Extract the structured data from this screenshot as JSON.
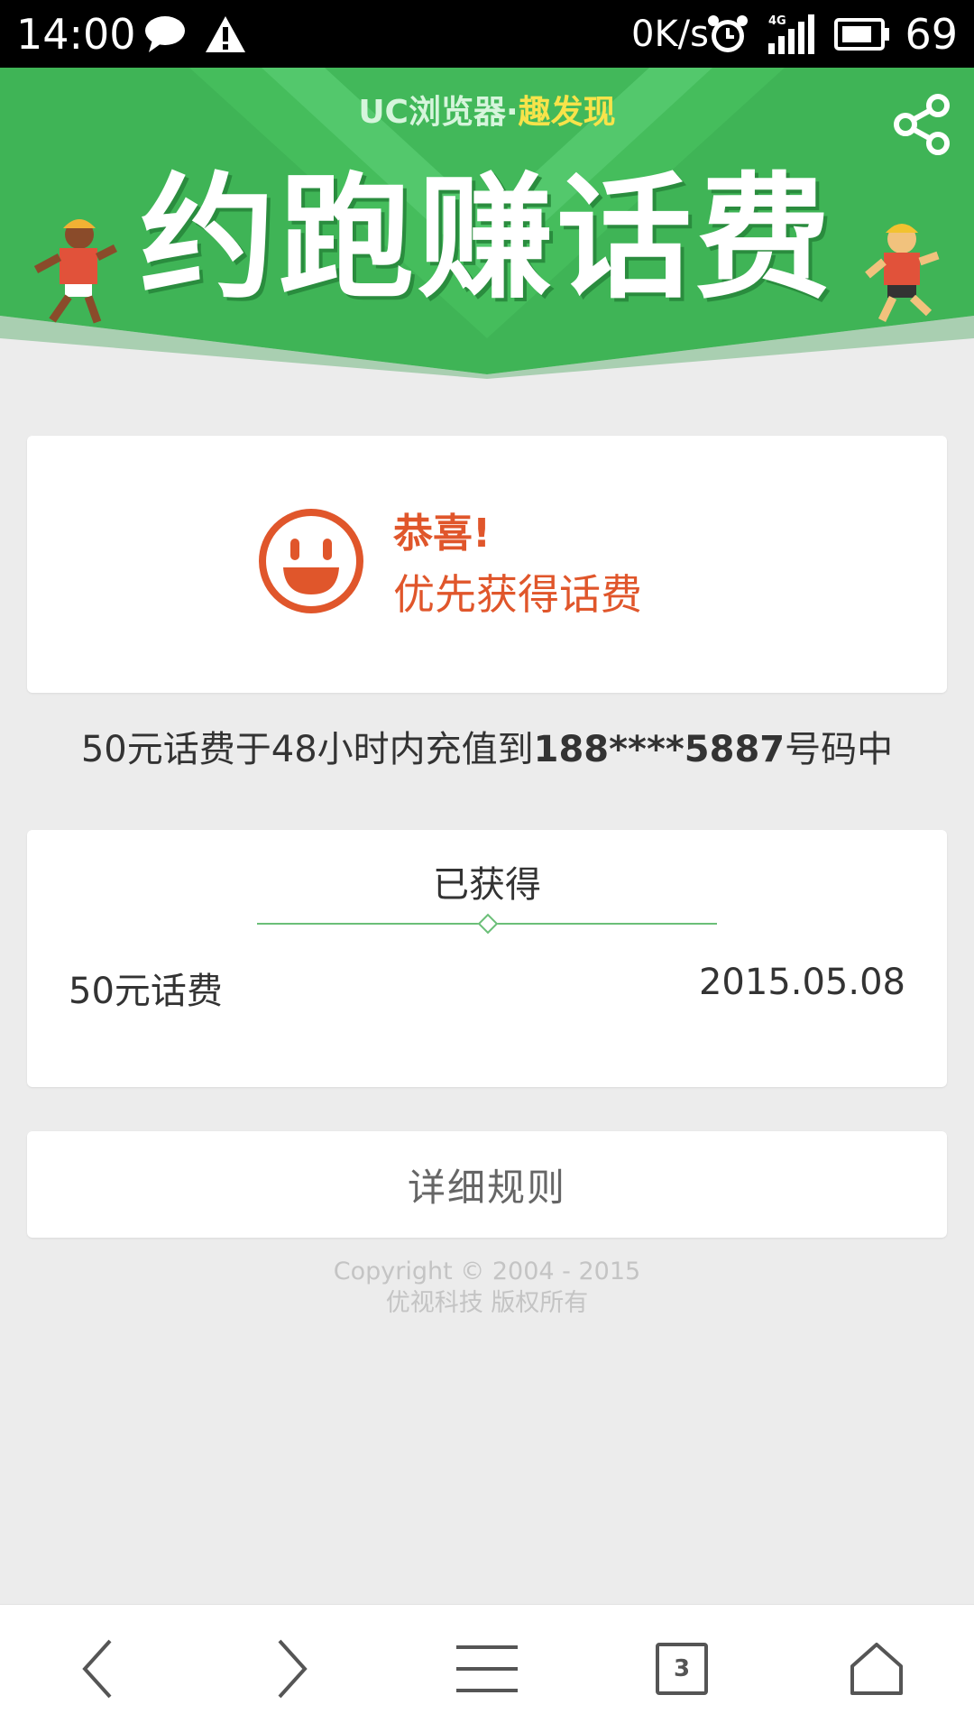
{
  "status_bar": {
    "time": "14:00",
    "speed": "0K/s",
    "network": "4G",
    "battery": "69",
    "icons": [
      "message-icon",
      "warning-icon",
      "alarm-icon",
      "signal-icon",
      "battery-icon"
    ]
  },
  "banner": {
    "brand": "UC浏览器",
    "brand_accent": "趣发现",
    "headline": "约跑赚话费",
    "share_icon": "share-icon"
  },
  "congrats": {
    "title": "恭喜!",
    "subtitle": "优先获得话费",
    "icon": "smiley-icon"
  },
  "recharge": {
    "prefix": "50元话费于48小时内充值到",
    "phone": "188****5887",
    "suffix": "号码中"
  },
  "earned": {
    "title": "已获得",
    "item": "50元话费",
    "date": "2015.05.08"
  },
  "rules_button": "详细规则",
  "copyright": {
    "line1": "Copyright © 2004 - 2015",
    "line2": "优视科技 版权所有"
  },
  "nav": {
    "tab_count": "3",
    "icons": [
      "back-icon",
      "forward-icon",
      "menu-icon",
      "tabs-icon",
      "home-icon"
    ]
  },
  "colors": {
    "banner_green": "#3fb456",
    "accent_orange": "#e0562b",
    "divider_green": "#6bbf78"
  }
}
